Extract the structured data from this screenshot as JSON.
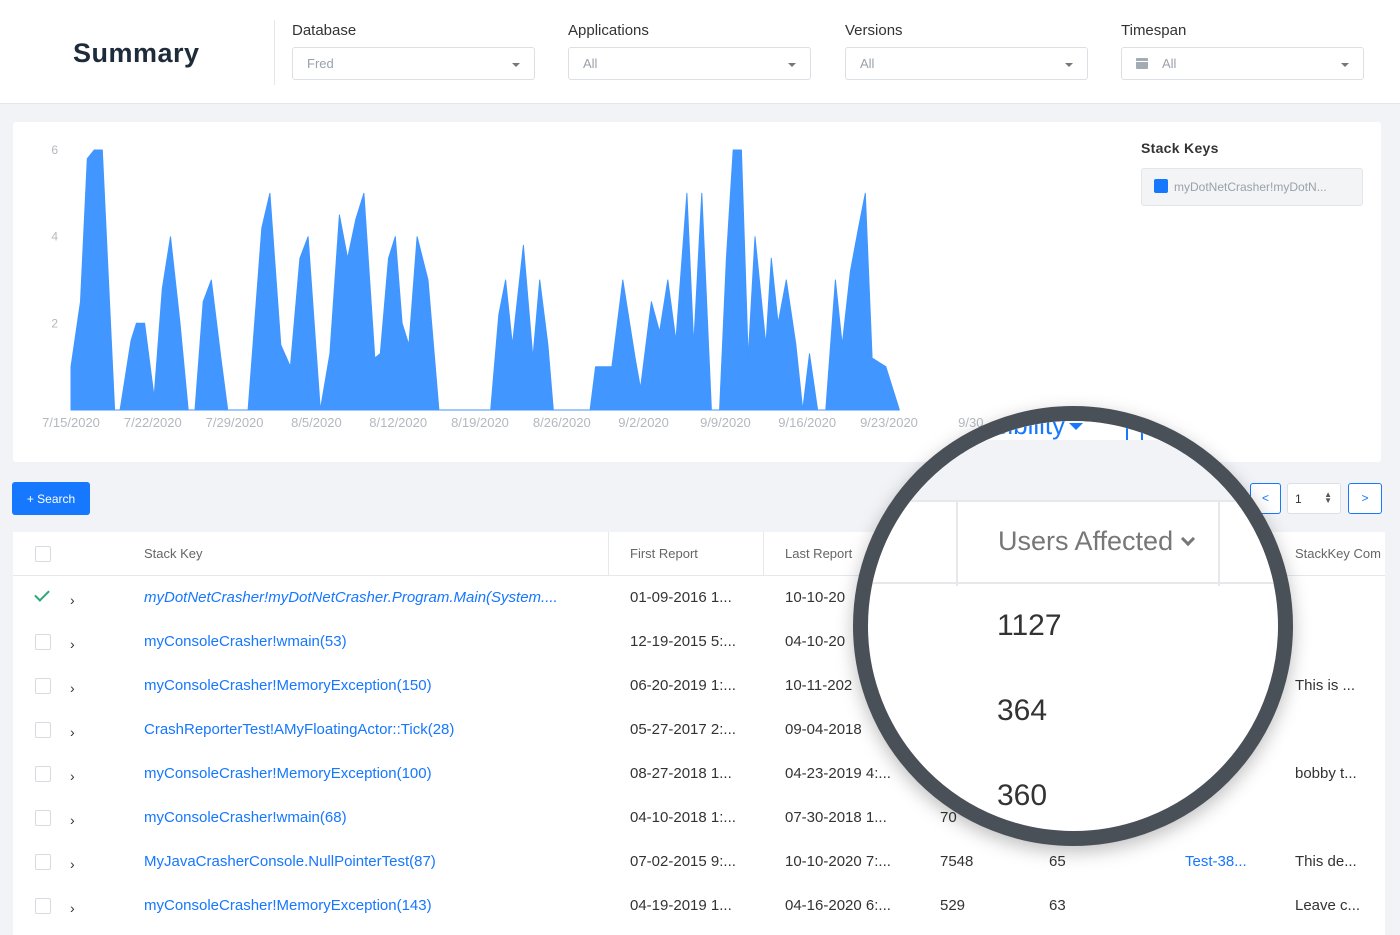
{
  "header": {
    "title": "Summary",
    "filters": [
      {
        "label": "Database",
        "value": "Fred"
      },
      {
        "label": "Applications",
        "value": "All"
      },
      {
        "label": "Versions",
        "value": "All"
      },
      {
        "label": "Timespan",
        "value": "All"
      }
    ]
  },
  "legend": {
    "title": "Stack Keys",
    "item": "myDotNetCrasher!myDotN...",
    "color": "#1677ff"
  },
  "chart_data": {
    "type": "area",
    "title": "",
    "xlabel": "",
    "ylabel": "",
    "ylim": [
      0,
      6
    ],
    "yticks": [
      2,
      4,
      6
    ],
    "x_tick_labels": [
      "7/15/2020",
      "7/22/2020",
      "7/29/2020",
      "8/5/2020",
      "8/12/2020",
      "8/19/2020",
      "8/26/2020",
      "9/2/2020",
      "9/9/2020",
      "9/16/2020",
      "9/23/2020",
      "9/30"
    ],
    "series": [
      {
        "color": "#4196ff",
        "points": [
          [
            0,
            1
          ],
          [
            0.35,
            2.5
          ],
          [
            0.6,
            5.8
          ],
          [
            0.85,
            6
          ],
          [
            1.15,
            6
          ],
          [
            1.6,
            0
          ],
          [
            1.8,
            0
          ],
          [
            2.2,
            1.6
          ],
          [
            2.4,
            2
          ],
          [
            2.7,
            2
          ],
          [
            3.05,
            0.3
          ],
          [
            3.35,
            2.8
          ],
          [
            3.65,
            4
          ],
          [
            4.0,
            2
          ],
          [
            4.3,
            0
          ],
          [
            4.55,
            0
          ],
          [
            4.85,
            2.5
          ],
          [
            5.15,
            3
          ],
          [
            5.5,
            1.2
          ],
          [
            5.75,
            0
          ],
          [
            6.5,
            0
          ],
          [
            7.0,
            4.2
          ],
          [
            7.3,
            5
          ],
          [
            7.7,
            1.5
          ],
          [
            8.05,
            1
          ],
          [
            8.4,
            3.5
          ],
          [
            8.7,
            4
          ],
          [
            9.15,
            0
          ],
          [
            9.5,
            1.3
          ],
          [
            9.85,
            4.5
          ],
          [
            10.15,
            3.5
          ],
          [
            10.45,
            4.4
          ],
          [
            10.75,
            5
          ],
          [
            11.15,
            1.2
          ],
          [
            11.35,
            1.3
          ],
          [
            11.65,
            3.5
          ],
          [
            11.9,
            4
          ],
          [
            12.15,
            2
          ],
          [
            12.4,
            1.5
          ],
          [
            12.7,
            4
          ],
          [
            13.1,
            3
          ],
          [
            13.5,
            0
          ],
          [
            15.4,
            0
          ],
          [
            15.7,
            2.2
          ],
          [
            15.95,
            3
          ],
          [
            16.2,
            1.5
          ],
          [
            16.6,
            3.8
          ],
          [
            16.95,
            1.2
          ],
          [
            17.2,
            3
          ],
          [
            17.5,
            1.5
          ],
          [
            17.7,
            0
          ],
          [
            19.05,
            0
          ],
          [
            19.25,
            1
          ],
          [
            19.85,
            1
          ],
          [
            20.25,
            3
          ],
          [
            20.7,
            1.2
          ],
          [
            20.9,
            0.5
          ],
          [
            21.3,
            2.5
          ],
          [
            21.6,
            1.8
          ],
          [
            21.9,
            3
          ],
          [
            22.2,
            1.6
          ],
          [
            22.6,
            5
          ],
          [
            22.85,
            1.5
          ],
          [
            23.15,
            5
          ],
          [
            23.5,
            0
          ],
          [
            23.8,
            0
          ],
          [
            24.05,
            3.5
          ],
          [
            24.3,
            6
          ],
          [
            24.6,
            6
          ],
          [
            24.85,
            1.2
          ],
          [
            25.1,
            4
          ],
          [
            25.5,
            1.5
          ],
          [
            25.7,
            3.5
          ],
          [
            25.95,
            2
          ],
          [
            26.25,
            3
          ],
          [
            26.6,
            1.5
          ],
          [
            26.85,
            0
          ],
          [
            27.1,
            1.3
          ],
          [
            27.4,
            0
          ],
          [
            27.7,
            0
          ],
          [
            28.05,
            3
          ],
          [
            28.3,
            1.5
          ],
          [
            28.6,
            3.2
          ],
          [
            28.9,
            4.2
          ],
          [
            29.15,
            5
          ],
          [
            29.4,
            1.2
          ],
          [
            29.9,
            1
          ],
          [
            30.4,
            0
          ]
        ]
      }
    ]
  },
  "controls": {
    "search_label": "+ Search",
    "prev_label": "<",
    "next_label": ">",
    "page_value": "1"
  },
  "table": {
    "columns": [
      "Stack Key",
      "First Report",
      "Last Report",
      "StackKey Com"
    ],
    "rows": [
      {
        "stack_key": "myDotNetCrasher!myDotNetCrasher.Program.Main(System....",
        "first": "01-09-2016 1...",
        "last": "10-10-20",
        "c4": "",
        "c5": "",
        "c6": "",
        "comment": "",
        "checked": true
      },
      {
        "stack_key": "myConsoleCrasher!wmain(53)",
        "first": "12-19-2015 5:...",
        "last": "04-10-20",
        "c4": "",
        "c5": "",
        "c6": "",
        "comment": "",
        "checked": false
      },
      {
        "stack_key": "myConsoleCrasher!MemoryException(150)",
        "first": "06-20-2019 1:...",
        "last": "10-11-202",
        "c4": "",
        "c5": "",
        "c6": "",
        "comment": "This is ...",
        "checked": false
      },
      {
        "stack_key": "CrashReporterTest!AMyFloatingActor::Tick(28)",
        "first": "05-27-2017 2:...",
        "last": "09-04-2018",
        "c4": "",
        "c5": "",
        "c6": "",
        "comment": "",
        "checked": false
      },
      {
        "stack_key": "myConsoleCrasher!MemoryException(100)",
        "first": "08-27-2018 1...",
        "last": "04-23-2019 4:...",
        "c4": "",
        "c5": "",
        "c6": "",
        "comment": "bobby t...",
        "checked": false
      },
      {
        "stack_key": "myConsoleCrasher!wmain(68)",
        "first": "04-10-2018 1:...",
        "last": "07-30-2018 1...",
        "c4": "70",
        "c5": "",
        "c6": "",
        "comment": "",
        "checked": false
      },
      {
        "stack_key": "MyJavaCrasherConsole.NullPointerTest(87)",
        "first": "07-02-2015 9:...",
        "last": "10-10-2020 7:...",
        "c4": "7548",
        "c5": "65",
        "c6": "Test-38...",
        "comment": "This de...",
        "checked": false
      },
      {
        "stack_key": "myConsoleCrasher!MemoryException(143)",
        "first": "04-19-2019 1...",
        "last": "04-16-2020 6:...",
        "c4": "529",
        "c5": "63",
        "c6": "",
        "comment": "Leave c...",
        "checked": false
      }
    ]
  },
  "magnifier": {
    "button_label": "n Visibility",
    "column_label": "Users Affected",
    "values": [
      "1127",
      "364",
      "360"
    ]
  }
}
